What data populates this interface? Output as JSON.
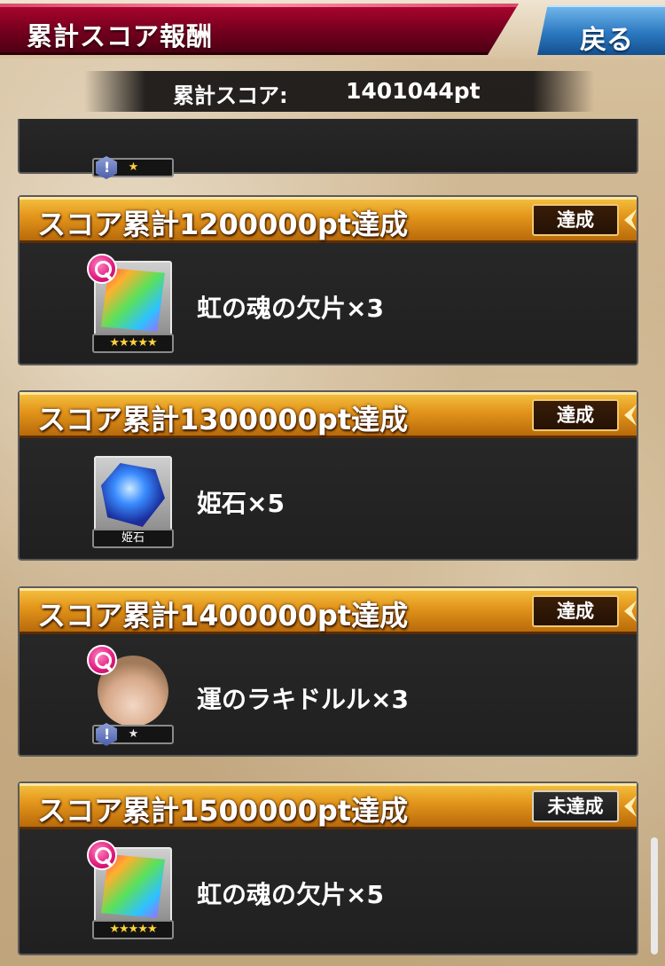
{
  "header": {
    "title": "累計スコア報酬",
    "back_label": "戻る"
  },
  "score": {
    "label": "累計スコア:",
    "value": "1401044pt"
  },
  "rewards": [
    {
      "title": "スコア累計1200000pt達成",
      "status": "達成",
      "item_name": "虹の魂の欠片×3",
      "icon": "rainbow-soul-shard-icon",
      "plate": "★★★★★"
    },
    {
      "title": "スコア累計1300000pt達成",
      "status": "達成",
      "item_name": "姫石×5",
      "icon": "princess-stone-icon",
      "plate": "姫石"
    },
    {
      "title": "スコア累計1400000pt達成",
      "status": "達成",
      "item_name": "運のラキドルル×3",
      "icon": "lucky-doll-icon",
      "plate": "★"
    },
    {
      "title": "スコア累計1500000pt達成",
      "status": "未達成",
      "item_name": "虹の魂の欠片×5",
      "icon": "rainbow-soul-shard-icon",
      "plate": "★★★★★"
    }
  ],
  "partial_card": {
    "plate": "★"
  },
  "colors": {
    "title_banner": "#7a0020",
    "back_button": "#2b78c0",
    "card_header": "#e3951b",
    "zoom_icon": "#e0197d"
  }
}
